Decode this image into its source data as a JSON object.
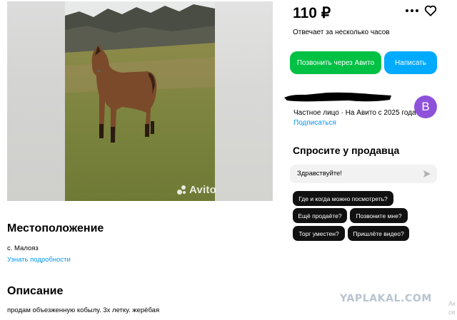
{
  "listing": {
    "price": "110 ₽",
    "reply_time": "Отвечает за несколько часов",
    "watermark_text": "Avito"
  },
  "actions": {
    "call_label": "Позвонить через Авито",
    "write_label": "Написать"
  },
  "seller": {
    "info": "Частное лицо · На Авито с 2025 года",
    "subscribe_label": "Подписаться",
    "avatar_letter": "В",
    "avatar_color": "#8d52d9"
  },
  "ask_seller": {
    "title": "Спросите у продавца",
    "input_value": "Здравствуйте!",
    "quick_questions": [
      "Где и когда можно посмотреть?",
      "Ещё продаёте?",
      "Позвоните мне?",
      "Торг уместен?",
      "Пришлёте видео?"
    ]
  },
  "location": {
    "title": "Местоположение",
    "place": "с. Малояз",
    "details_link": "Узнать подробности"
  },
  "description": {
    "title": "Описание",
    "text": "продам объезженную кобылу. 3х летку. жерёбая"
  },
  "overlay": {
    "site_watermark": "YAPLAKAL.COM",
    "cut_text": "Ак\nсе"
  },
  "colors": {
    "call_button": "#00c144",
    "write_button": "#00aaff",
    "link": "#0099f7",
    "chip": "#111111"
  }
}
